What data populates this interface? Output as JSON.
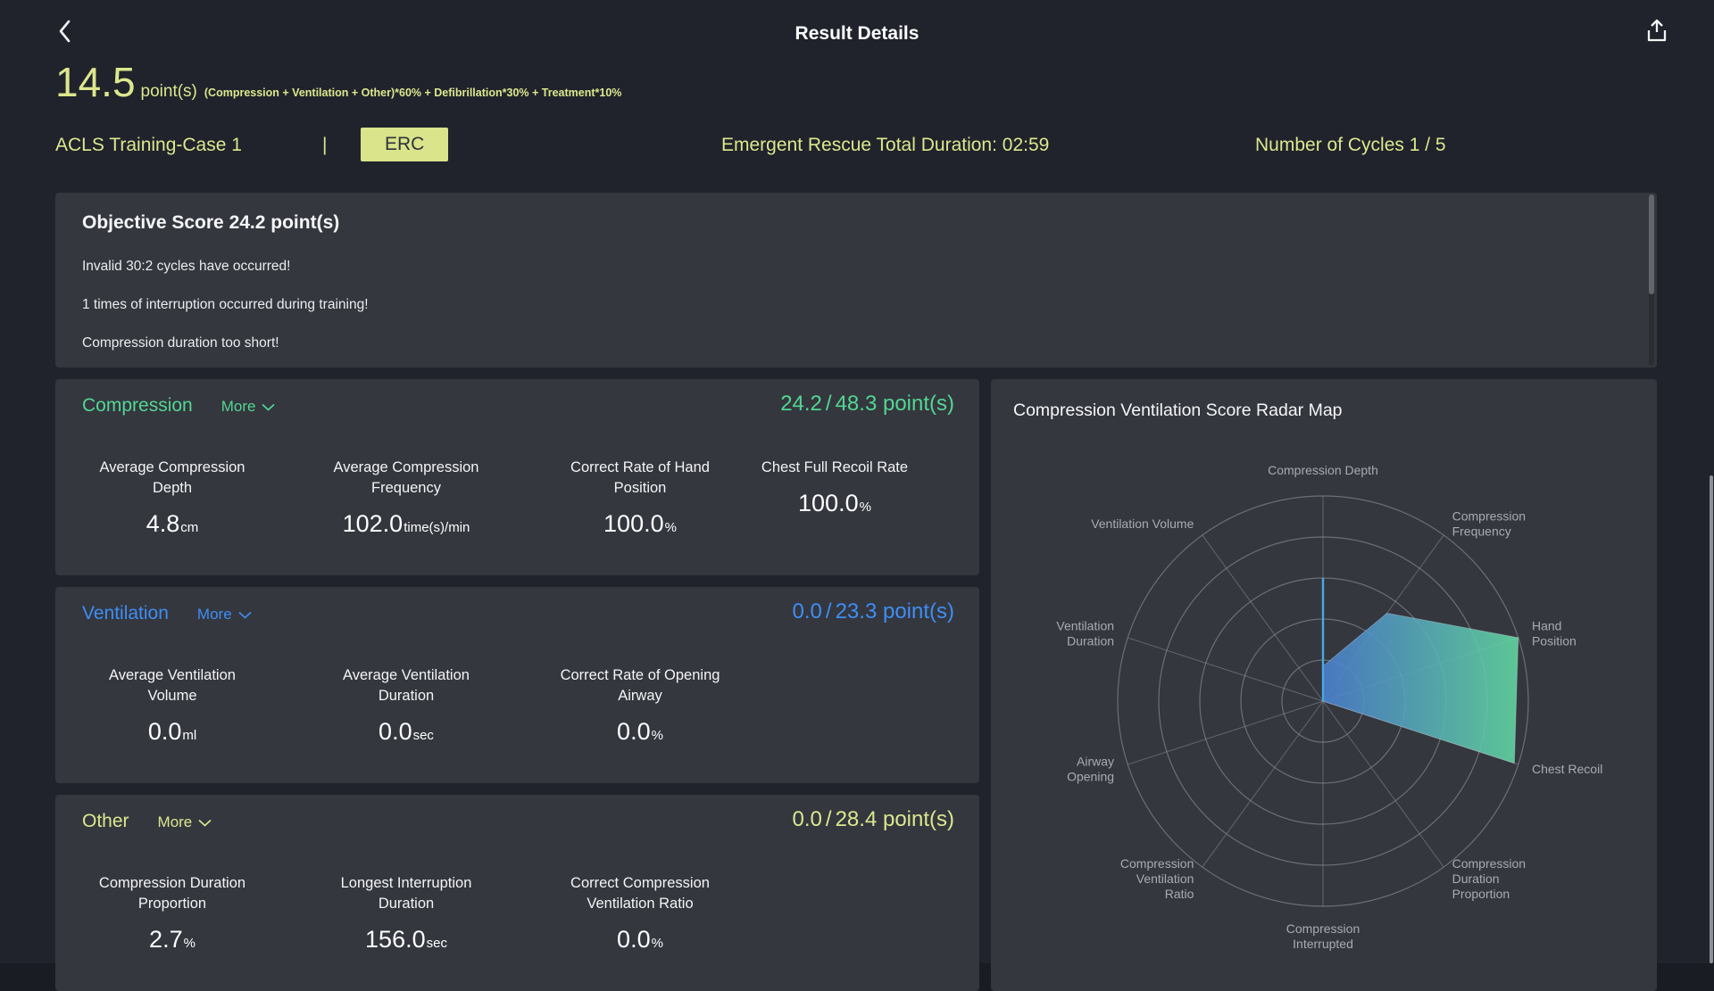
{
  "header": {
    "title": "Result Details"
  },
  "summary": {
    "score": "14.5",
    "unit": "point(s)",
    "formula": "(Compression + Ventilation + Other)*60% + Defibrillation*30% + Treatment*10%",
    "color": "#dce78e"
  },
  "session": {
    "case_name": "ACLS Training-Case 1",
    "separator": "|",
    "badge": "ERC",
    "badge_bg": "#d9e48b",
    "badge_text_color": "#2f323a",
    "duration": "Emergent Rescue Total Duration: 02:59",
    "cycles": "Number of Cycles 1 / 5"
  },
  "objective": {
    "title": "Objective Score 24.2 point(s)",
    "messages": [
      "Invalid 30:2 cycles have occurred!",
      "1 times of interruption occurred during training!",
      "Compression duration too short!"
    ]
  },
  "ui": {
    "more_label": "More",
    "score_separator": "/"
  },
  "sections": [
    {
      "title": "Compression",
      "accent": "#53d693",
      "score_current": "24.2",
      "score_max": "48.3",
      "score_unit": "point(s)",
      "metrics": [
        {
          "label": "Average Compression Depth",
          "value": "4.8",
          "unit": "cm"
        },
        {
          "label": "Average Compression Frequency",
          "value": "102.0",
          "unit": "time(s)/min"
        },
        {
          "label": "Correct Rate of Hand Position",
          "value": "100.0",
          "unit": "%"
        },
        {
          "label": "Chest Full Recoil Rate",
          "value": "100.0",
          "unit": "%"
        }
      ]
    },
    {
      "title": "Ventilation",
      "accent": "#3e8ef5",
      "score_current": "0.0",
      "score_max": "23.3",
      "score_unit": "point(s)",
      "metrics": [
        {
          "label": "Average Ventilation Volume",
          "value": "0.0",
          "unit": "ml"
        },
        {
          "label": "Average Ventilation Duration",
          "value": "0.0",
          "unit": "sec"
        },
        {
          "label": "Correct Rate of Opening Airway",
          "value": "0.0",
          "unit": "%"
        }
      ]
    },
    {
      "title": "Other",
      "accent": "#dce78e",
      "score_current": "0.0",
      "score_max": "28.4",
      "score_unit": "point(s)",
      "metrics": [
        {
          "label": "Compression Duration Proportion",
          "value": "2.7",
          "unit": "%"
        },
        {
          "label": "Longest Interruption Duration",
          "value": "156.0",
          "unit": "sec"
        },
        {
          "label": "Correct Compression Ventilation Ratio",
          "value": "0.0",
          "unit": "%"
        }
      ]
    }
  ],
  "radar": {
    "title": "Compression Ventilation Score Radar Map",
    "chart_data": {
      "type": "radar",
      "title": "Compression Ventilation Score Radar Map",
      "rings": 5,
      "max": 1,
      "axes": [
        {
          "label": "Compression Depth",
          "lines": [
            "Compression Depth"
          ]
        },
        {
          "label": "Compression Frequency",
          "lines": [
            "Compression",
            "Frequency"
          ]
        },
        {
          "label": "Hand Position",
          "lines": [
            "Hand",
            "Position"
          ]
        },
        {
          "label": "Chest Recoil",
          "lines": [
            "Chest Recoil"
          ]
        },
        {
          "label": "Compression Duration Proportion",
          "lines": [
            "Compression",
            "Duration",
            "Proportion"
          ]
        },
        {
          "label": "Compression Interrupted",
          "lines": [
            "Compression",
            "Interrupted"
          ]
        },
        {
          "label": "Compression Ventilation Ratio",
          "lines": [
            "Compression",
            "Ventilation",
            "Ratio"
          ]
        },
        {
          "label": "Airway Opening",
          "lines": [
            "Airway",
            "Opening"
          ]
        },
        {
          "label": "Ventilation Duration",
          "lines": [
            "Ventilation",
            "Duration"
          ]
        },
        {
          "label": "Ventilation Volume",
          "lines": [
            "Ventilation Volume"
          ]
        }
      ],
      "values": [
        0.17,
        0.53,
        1.0,
        0.98,
        0,
        0,
        0,
        0,
        0,
        0
      ],
      "depth_spike_value": 0.6,
      "spike_color": "#48a9e6",
      "gradient": [
        "#4b80d1",
        "#62d9a2"
      ],
      "grid_color": "#8b8e94",
      "label_color": "#a8abb1",
      "legend_position": "none"
    }
  }
}
